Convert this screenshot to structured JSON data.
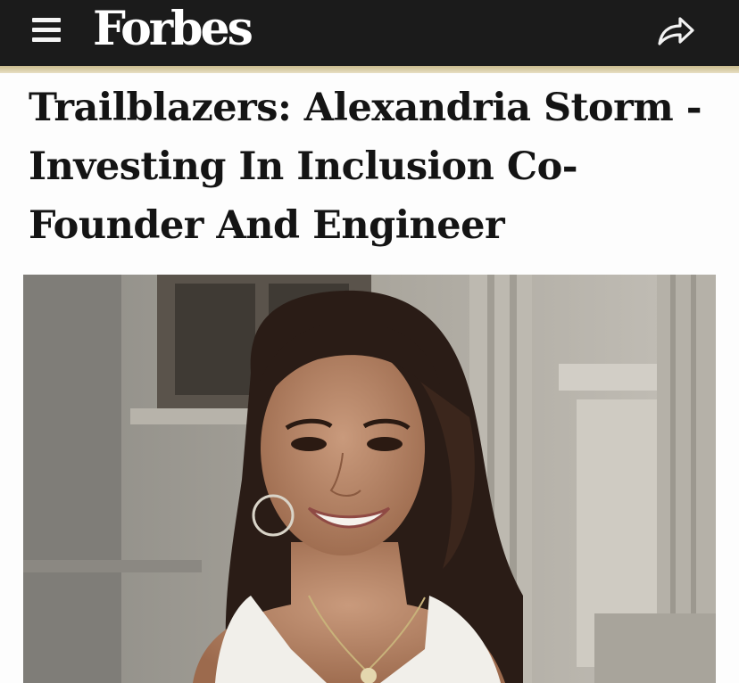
{
  "header": {
    "brand": "Forbes",
    "menu_icon": "hamburger-menu-icon",
    "share_icon": "share-arrow-icon",
    "background_color": "#1b1b1b",
    "accent_rule_color": "#d6caa3"
  },
  "article": {
    "headline": "Trailblazers: Alexandria Storm - Investing In Inclusion Co-Founder And Engineer"
  }
}
